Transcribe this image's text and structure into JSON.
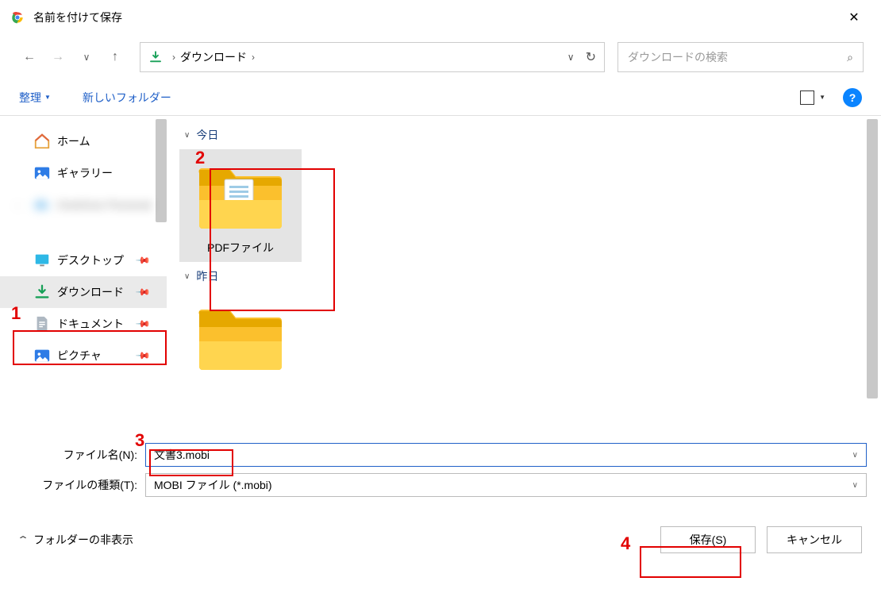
{
  "title": "名前を付けて保存",
  "breadcrumb": {
    "location": "ダウンロード"
  },
  "search": {
    "placeholder": "ダウンロードの検索"
  },
  "toolbar": {
    "organize": "整理",
    "new_folder": "新しいフォルダー"
  },
  "sidebar": {
    "items": [
      {
        "label": "ホーム"
      },
      {
        "label": "ギャラリー"
      },
      {
        "label": ""
      },
      {
        "label": "デスクトップ"
      },
      {
        "label": "ダウンロード"
      },
      {
        "label": "ドキュメント"
      },
      {
        "label": "ピクチャ"
      }
    ]
  },
  "groups": {
    "today": "今日",
    "yesterday": "昨日"
  },
  "folders": {
    "pdf": {
      "label": "PDFファイル"
    }
  },
  "form": {
    "filename_label": "ファイル名(N):",
    "filename_value": "文書3.mobi",
    "filetype_label": "ファイルの種類(T):",
    "filetype_value": "MOBI ファイル (*.mobi)"
  },
  "footer": {
    "hide_folders": "フォルダーの非表示",
    "save": "保存(S)",
    "cancel": "キャンセル"
  },
  "annotations": {
    "a1": "1",
    "a2": "2",
    "a3": "3",
    "a4": "4"
  }
}
